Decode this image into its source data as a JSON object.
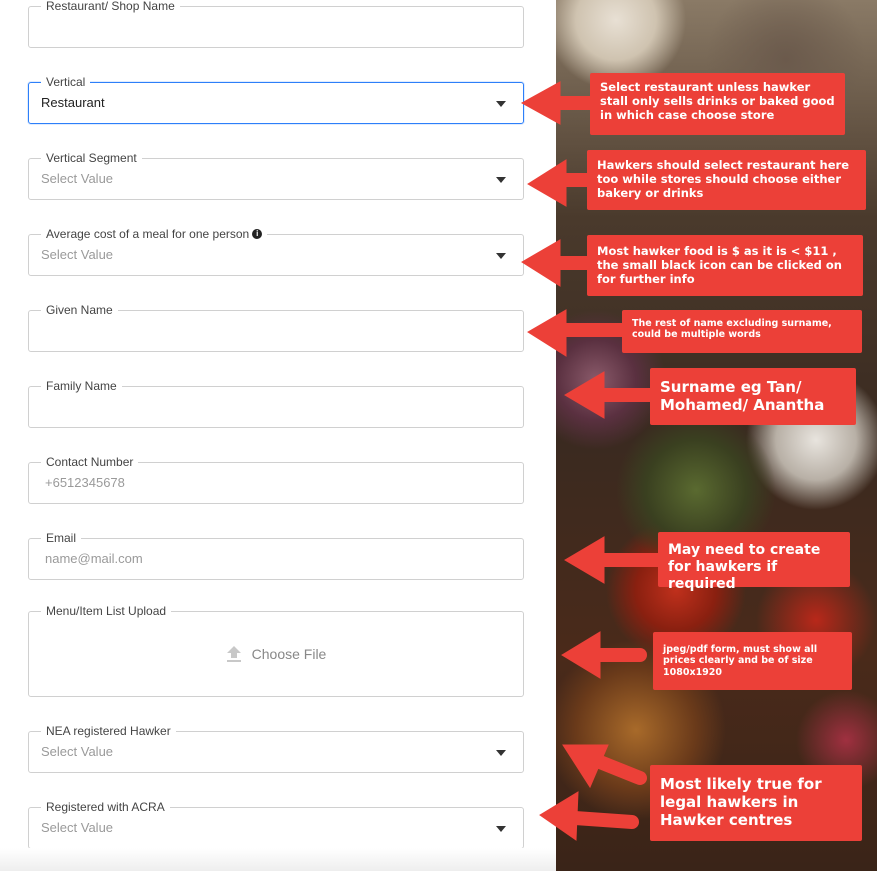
{
  "form": {
    "fields": [
      {
        "label": "Restaurant/ Shop Name",
        "value": "",
        "placeholder": ""
      },
      {
        "label": "Vertical",
        "value": "Restaurant"
      },
      {
        "label": "Vertical Segment",
        "placeholder": "Select Value"
      },
      {
        "label": "Average cost of a meal for one person",
        "placeholder": "Select Value",
        "info_icon": "info-icon"
      },
      {
        "label": "Given Name",
        "value": ""
      },
      {
        "label": "Family Name",
        "value": ""
      },
      {
        "label": "Contact Number",
        "placeholder": "+6512345678"
      },
      {
        "label": "Email",
        "placeholder": "name@mail.com"
      },
      {
        "label": "Menu/Item List Upload",
        "button": "Choose File",
        "icon": "upload-icon"
      },
      {
        "label": "NEA registered Hawker",
        "placeholder": "Select Value"
      },
      {
        "label": "Registered with ACRA",
        "placeholder": "Select Value"
      }
    ]
  },
  "annotations": [
    "Select restaurant unless hawker stall only sells drinks or baked good in which case choose store",
    "Hawkers should select restaurant here too while stores should choose either bakery or drinks",
    "Most hawker food is $ as it is < $11 , the small black icon can be clicked on for further info",
    "The rest of name excluding surname, could be multiple words",
    "Surname eg Tan/ Mohamed/ Anantha",
    "May need to create for hawkers if required",
    "jpeg/pdf form, must show all prices clearly and be of size 1080x1920",
    "Most likely true for legal hawkers in Hawker centres"
  ],
  "colors": {
    "annotation": "#ec4038",
    "focus": "#2d7ff9"
  }
}
